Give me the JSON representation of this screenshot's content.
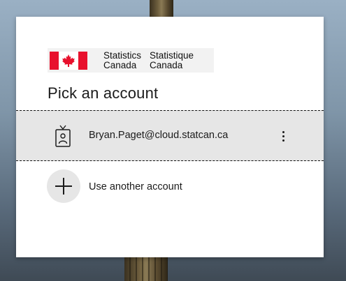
{
  "logo": {
    "en_line1": "Statistics",
    "en_line2": "Canada",
    "fr_line1": "Statistique",
    "fr_line2": "Canada",
    "flag_icon": "canada-flag-icon",
    "flag_color": "#e8112d"
  },
  "title": "Pick an account",
  "accounts": [
    {
      "email": "Bryan.Paget@cloud.statcan.ca",
      "icon": "work-badge-icon",
      "menu_icon": "more-options-icon",
      "selected": true
    }
  ],
  "use_another": {
    "label": "Use another account",
    "icon": "plus-icon"
  }
}
